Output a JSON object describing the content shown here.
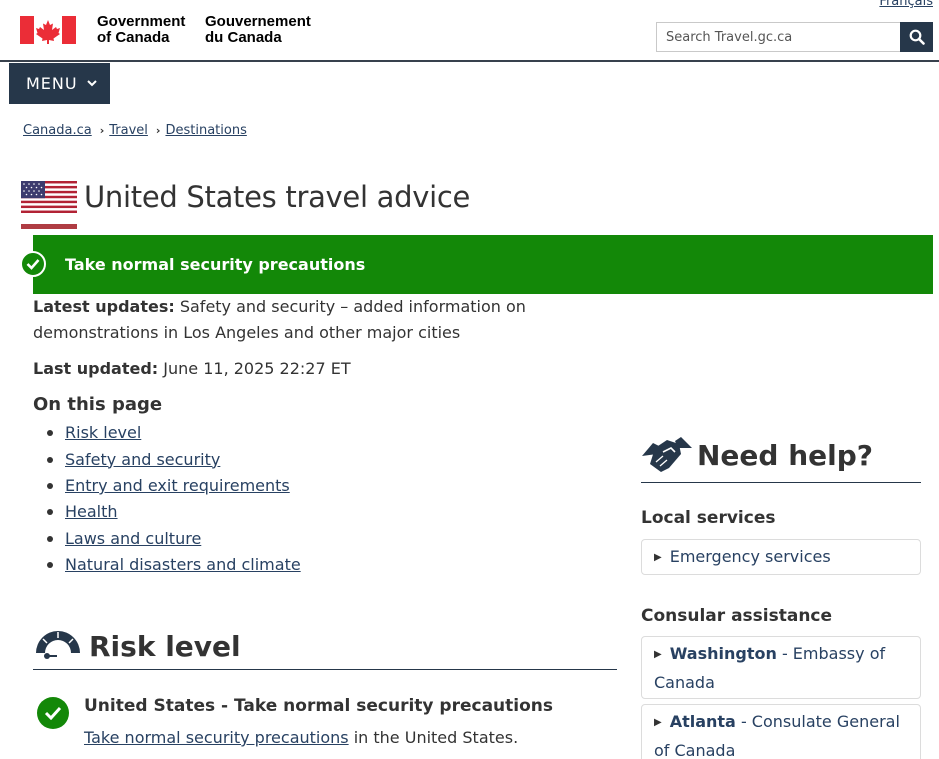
{
  "header": {
    "lang_link": "Français",
    "wordmark_en": "Government\nof Canada",
    "wordmark_fr": "Gouvernement\ndu Canada",
    "search_placeholder": "Search Travel.gc.ca"
  },
  "nav": {
    "menu_label": "MENU",
    "breadcrumb": [
      "Canada.ca",
      "Travel",
      "Destinations"
    ]
  },
  "page": {
    "title": "United States travel advice",
    "alert": "Take normal security precautions",
    "latest_label": "Latest updates:",
    "latest_text": "Safety and security – added information on demonstrations in Los Angeles and other major cities",
    "last_label": "Last updated:",
    "last_text": "June 11, 2025 22:27 ET",
    "on_this_page": "On this page",
    "toc": [
      "Risk level",
      "Safety and security",
      "Entry and exit requirements",
      "Health",
      "Laws and culture",
      "Natural disasters and climate"
    ],
    "risk_title": "Risk level",
    "risk_sub": "United States - Take normal security precautions",
    "risk_link": "Take normal security precautions",
    "risk_suffix": " in the United States."
  },
  "sidebar": {
    "help_title": "Need help?",
    "local_heading": "Local services",
    "emergency": "Emergency services",
    "consular_heading": "Consular assistance",
    "washington_city": "Washington",
    "washington_rest": " - Embassy of Canada",
    "atlanta_city": "Atlanta",
    "atlanta_rest": " - Consulate General of Canada"
  },
  "colors": {
    "brand_dark": "#26374a",
    "alert_green": "#138808",
    "flag_red": "#eb2d37",
    "link": "#284162"
  },
  "icons": [
    "canada-flag-icon",
    "search-icon",
    "chevron-down-icon",
    "us-flag-icon",
    "check-circle-icon",
    "gauge-icon",
    "handshake-icon",
    "triangle-right-icon"
  ]
}
